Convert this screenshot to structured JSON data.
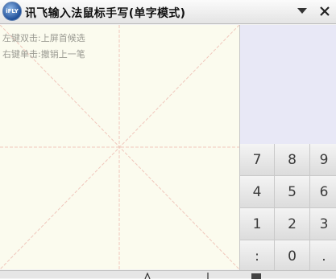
{
  "titlebar": {
    "logo_text": "iFLY",
    "title": "讯飞输入法鼠标手写(单字模式)",
    "dropdown_icon": "triangle-down-icon",
    "close_icon": "close-icon"
  },
  "write_area": {
    "hints": [
      "左键双击:上屏首候选",
      "右键单击:撤销上一笔"
    ]
  },
  "keypad": {
    "keys": [
      "7",
      "8",
      "9",
      "4",
      "5",
      "6",
      "1",
      "2",
      "3",
      ":",
      "0",
      "."
    ]
  },
  "colors": {
    "write_bg": "#fbfbee",
    "candidate_bg": "#e8e8f6",
    "guide_line": "#f0c7bc"
  }
}
